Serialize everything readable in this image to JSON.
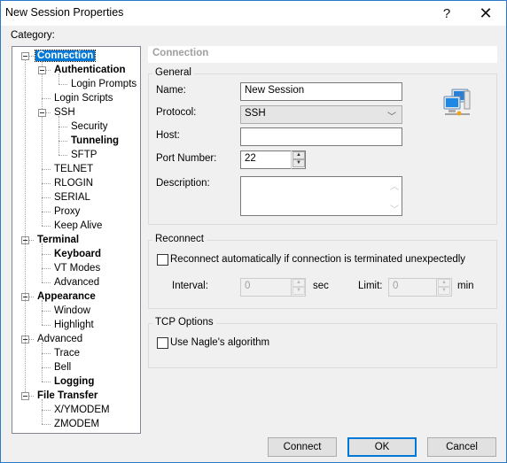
{
  "window": {
    "title": "New Session Properties",
    "help_glyph": "?",
    "close_glyph": "✕"
  },
  "category_label": "Category:",
  "tree": [
    {
      "label": "Connection",
      "level": 0,
      "bold": true,
      "selected": true,
      "expander": true
    },
    {
      "label": "Authentication",
      "level": 1,
      "bold": true,
      "expander": true
    },
    {
      "label": "Login Prompts",
      "level": 2
    },
    {
      "label": "Login Scripts",
      "level": 1
    },
    {
      "label": "SSH",
      "level": 1,
      "expander": true
    },
    {
      "label": "Security",
      "level": 2
    },
    {
      "label": "Tunneling",
      "level": 2,
      "bold": true
    },
    {
      "label": "SFTP",
      "level": 2
    },
    {
      "label": "TELNET",
      "level": 1
    },
    {
      "label": "RLOGIN",
      "level": 1
    },
    {
      "label": "SERIAL",
      "level": 1
    },
    {
      "label": "Proxy",
      "level": 1
    },
    {
      "label": "Keep Alive",
      "level": 1
    },
    {
      "label": "Terminal",
      "level": 0,
      "bold": true,
      "expander": true
    },
    {
      "label": "Keyboard",
      "level": 1,
      "bold": true
    },
    {
      "label": "VT Modes",
      "level": 1
    },
    {
      "label": "Advanced",
      "level": 1
    },
    {
      "label": "Appearance",
      "level": 0,
      "bold": true,
      "expander": true
    },
    {
      "label": "Window",
      "level": 1
    },
    {
      "label": "Highlight",
      "level": 1
    },
    {
      "label": "Advanced",
      "level": 0,
      "expander": true
    },
    {
      "label": "Trace",
      "level": 1
    },
    {
      "label": "Bell",
      "level": 1
    },
    {
      "label": "Logging",
      "level": 1,
      "bold": true
    },
    {
      "label": "File Transfer",
      "level": 0,
      "bold": true,
      "expander": true
    },
    {
      "label": "X/YMODEM",
      "level": 1
    },
    {
      "label": "ZMODEM",
      "level": 1
    }
  ],
  "panel": {
    "header": "Connection",
    "general": {
      "title": "General",
      "name_label": "Name:",
      "name_value": "New Session",
      "protocol_label": "Protocol:",
      "protocol_value": "SSH",
      "host_label": "Host:",
      "host_value": "",
      "port_label": "Port Number:",
      "port_value": "22",
      "description_label": "Description:",
      "description_value": "",
      "icon": "network-computers-icon"
    },
    "reconnect": {
      "title": "Reconnect",
      "checkbox_label": "Reconnect automatically if connection is terminated unexpectedly",
      "checked": false,
      "interval_label": "Interval:",
      "interval_value": "0",
      "interval_unit": "sec",
      "limit_label": "Limit:",
      "limit_value": "0",
      "limit_unit": "min"
    },
    "tcp": {
      "title": "TCP Options",
      "nagle_label": "Use Nagle's algorithm",
      "checked": false
    }
  },
  "buttons": {
    "connect": "Connect",
    "ok": "OK",
    "cancel": "Cancel"
  }
}
